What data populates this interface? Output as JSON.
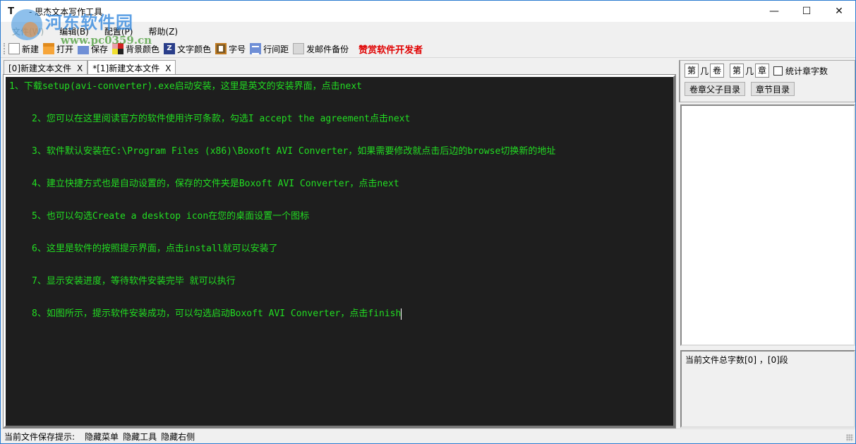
{
  "window": {
    "icon_glyph": "T",
    "title": "- 思杰文本写作工具",
    "minimize_glyph": "—",
    "maximize_glyph": "☐",
    "close_glyph": "✕"
  },
  "watermark": {
    "site_name": "河东软件园",
    "url": "www.pc0359.cn"
  },
  "menu": [
    {
      "label": "文件(W)"
    },
    {
      "label": "编辑(B)"
    },
    {
      "label": "配置(P)"
    },
    {
      "label": "帮助(Z)"
    }
  ],
  "toolbar": {
    "new_label": "新建",
    "open_label": "打开",
    "save_label": "保存",
    "bg_color_label": "背景颜色",
    "font_color_icon_glyph": "Z",
    "font_color_label": "文字颜色",
    "font_size_label": "字号",
    "line_spacing_label": "行间距",
    "email_backup_label": "发邮件备份",
    "sponsor_label": "赞赏软件开发者",
    "sponsor_color": "#e00000"
  },
  "tabs": [
    {
      "label": "[0]新建文本文件",
      "close": "X"
    },
    {
      "label": "*[1]新建文本文件",
      "close": "X",
      "active": true
    }
  ],
  "editor": {
    "background": "#1e1e1e",
    "text_color": "#22dd22",
    "lines": [
      "1、下载setup(avi-converter).exe启动安装，这里是英文的安装界面，点击next",
      "2、您可以在这里阅读官方的软件使用许可条款，勾选I accept the agreement点击next",
      "3、软件默认安装在C:\\Program Files (x86)\\Boxoft AVI Converter，如果需要修改就点击后边的browse切换新的地址",
      "4、建立快捷方式也是自动设置的，保存的文件夹是Boxoft AVI Converter，点击next",
      "5、也可以勾选Create a desktop icon在您的桌面设置一个图标",
      "6、这里是软件的按照提示界面，点击install就可以安装了",
      "7、显示安装进度，等待软件安装完毕 就可以执行",
      "8、如图所示，提示软件安装成功，可以勾选启动Boxoft AVI Converter，点击finish"
    ]
  },
  "right_panel": {
    "volume_prefix": "第",
    "volume_sep": "几",
    "volume_suffix": "卷",
    "chapter_prefix": "第",
    "chapter_sep": "几",
    "chapter_suffix": "章",
    "count_chapter_words_label": "统计章字数",
    "count_chapter_words_checked": false,
    "volume_chapter_toc_button": "卷章父子目录",
    "chapter_toc_button": "章节目录",
    "info_text": "当前文件总字数[0] ，[0]段"
  },
  "statusbar": {
    "save_hint_label": "当前文件保存提示:",
    "hide_menu": "隐藏菜单",
    "hide_tools": "隐藏工具",
    "hide_right": "隐藏右侧"
  }
}
